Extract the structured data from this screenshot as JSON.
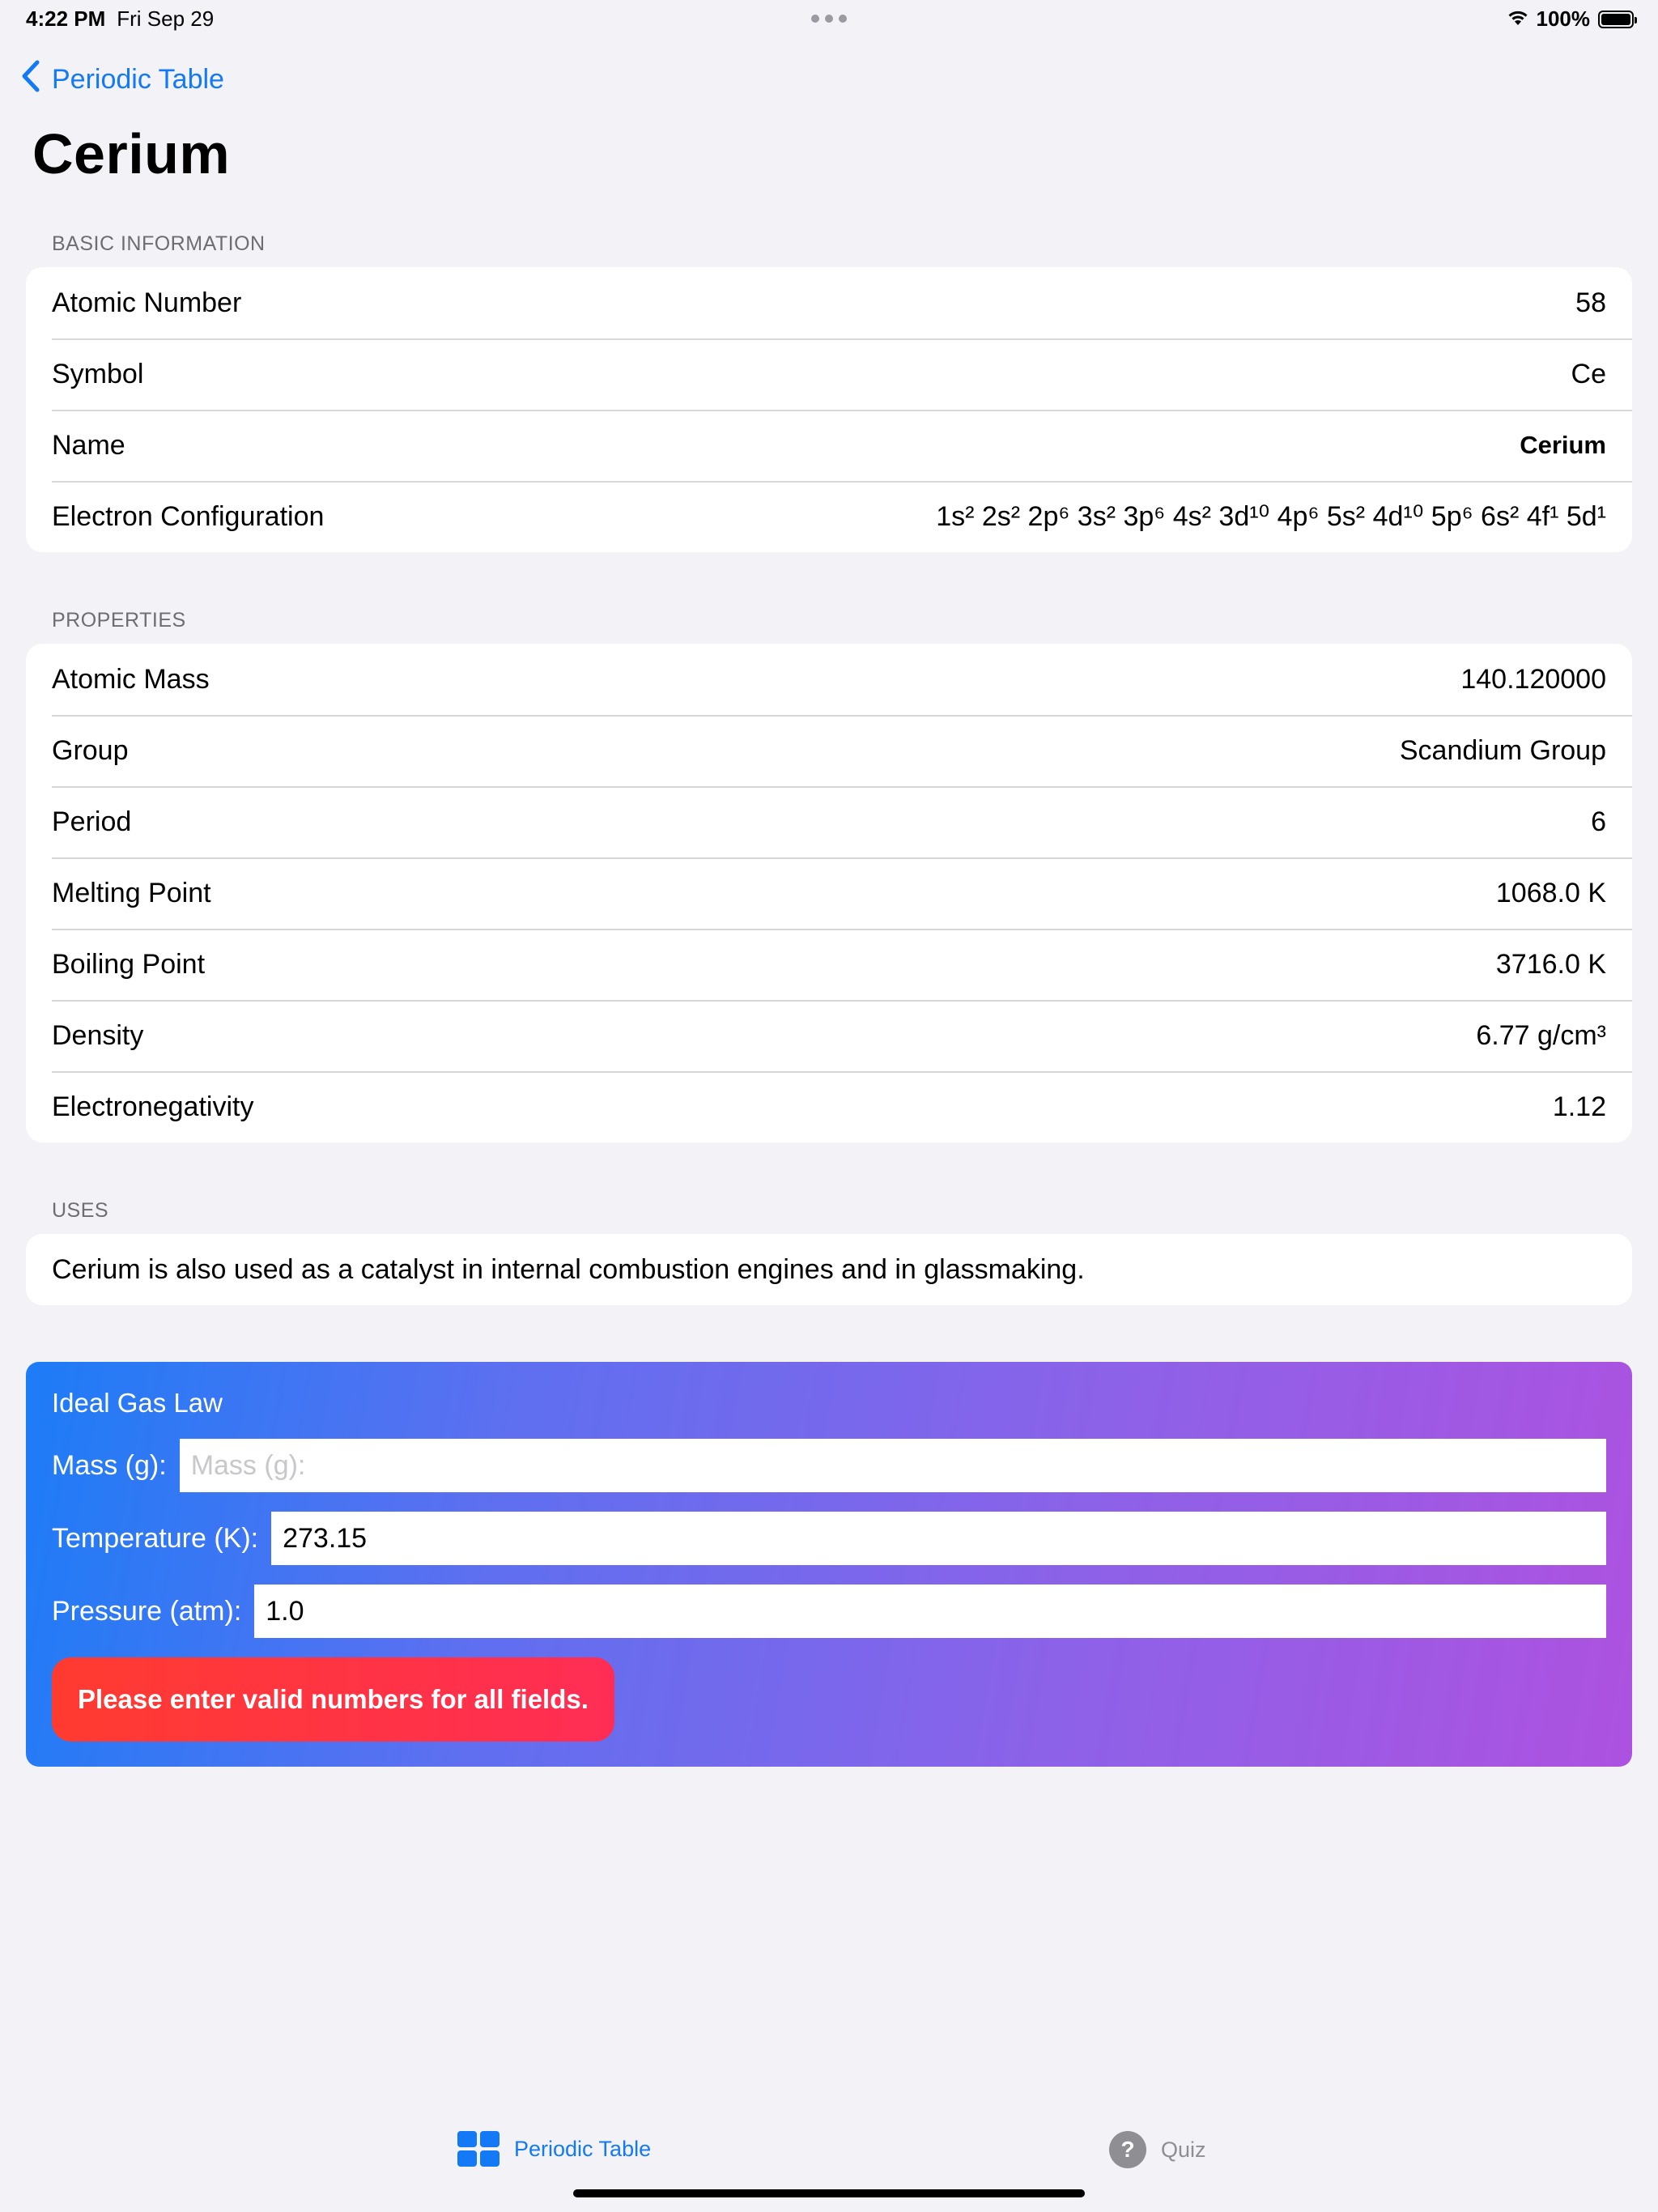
{
  "status_bar": {
    "time": "4:22 PM",
    "date": "Fri Sep 29",
    "battery": "100%"
  },
  "nav": {
    "back_label": "Periodic Table",
    "title": "Cerium"
  },
  "basic_information": {
    "header": "BASIC INFORMATION",
    "rows": [
      {
        "label": "Atomic Number",
        "value": "58"
      },
      {
        "label": "Symbol",
        "value": "Ce"
      },
      {
        "label": "Name",
        "value": "Cerium"
      },
      {
        "label": "Electron Configuration",
        "value": "1s² 2s² 2p⁶ 3s² 3p⁶ 4s² 3d¹⁰ 4p⁶ 5s² 4d¹⁰ 5p⁶ 6s² 4f¹ 5d¹"
      }
    ]
  },
  "properties": {
    "header": "PROPERTIES",
    "rows": [
      {
        "label": "Atomic Mass",
        "value": "140.120000"
      },
      {
        "label": "Group",
        "value": "Scandium Group"
      },
      {
        "label": "Period",
        "value": "6"
      },
      {
        "label": "Melting Point",
        "value": "1068.0 K"
      },
      {
        "label": "Boiling Point",
        "value": "3716.0 K"
      },
      {
        "label": "Density",
        "value": "6.77 g/cm³"
      },
      {
        "label": "Electronegativity",
        "value": "1.12"
      }
    ]
  },
  "uses": {
    "header": "USES",
    "text": "Cerium is also used as a catalyst in internal combustion engines and in glassmaking."
  },
  "ideal_gas_law": {
    "title": "Ideal Gas Law",
    "mass_label": "Mass (g):",
    "mass_value": "",
    "mass_placeholder": "Mass (g):",
    "temperature_label": "Temperature (K):",
    "temperature_value": "273.15",
    "pressure_label": "Pressure (atm):",
    "pressure_value": "1.0",
    "error_message": "Please enter valid numbers for all fields."
  },
  "tab_bar": {
    "tabs": [
      {
        "label": "Periodic Table",
        "icon": "grid-icon",
        "selected": true
      },
      {
        "label": "Quiz",
        "icon": "question-circle-icon",
        "selected": false
      }
    ]
  },
  "colors": {
    "accent": "#1479f5",
    "background": "#f2f2f7",
    "gradient_start": "#1d7cf6",
    "gradient_end": "#ad52e0",
    "error": "#ff3b30"
  }
}
